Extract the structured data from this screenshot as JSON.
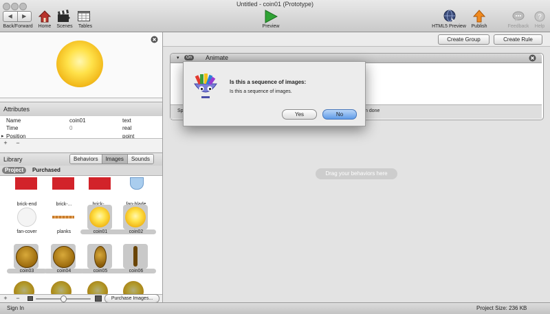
{
  "window": {
    "title": "Untitled - coin01 (Prototype)"
  },
  "toolbar": {
    "back_forward": "Back/Forward",
    "home": "Home",
    "scenes": "Scenes",
    "tables": "Tables",
    "preview": "Preview",
    "html5_preview": "HTML5 Preview",
    "publish": "Publish",
    "feedback": "Feedback",
    "help": "Help"
  },
  "attributes": {
    "title": "Attributes",
    "rows": [
      {
        "name": "Name",
        "value": "coin01",
        "type": "text"
      },
      {
        "name": "Time",
        "value": "0",
        "type": "real"
      },
      {
        "name": "Position",
        "value": "",
        "type": "point"
      }
    ],
    "add": "+",
    "remove": "−"
  },
  "library": {
    "title": "Library",
    "tabs": [
      "Behaviors",
      "Images",
      "Sounds"
    ],
    "active_tab": "Images",
    "subtabs": [
      "Project",
      "Purchased"
    ],
    "active_subtab": "Project",
    "items": [
      {
        "label": "brick-end",
        "kind": "brick"
      },
      {
        "label": "brick-...",
        "kind": "brick"
      },
      {
        "label": "brick-...",
        "kind": "brick"
      },
      {
        "label": "fan-blade",
        "kind": "fan"
      },
      {
        "label": "fan-cover",
        "kind": "cover"
      },
      {
        "label": "planks",
        "kind": "planks"
      },
      {
        "label": "coin01",
        "kind": "coin-bright"
      },
      {
        "label": "coin02",
        "kind": "coin"
      },
      {
        "label": "coin03",
        "kind": "coin-dark"
      },
      {
        "label": "coin04",
        "kind": "coin-dark"
      },
      {
        "label": "coin05",
        "kind": "coin-side"
      },
      {
        "label": "coin06",
        "kind": "coin-edge"
      }
    ],
    "purchase_button": "Purchase Images..."
  },
  "rules": {
    "create_group": "Create Group",
    "create_rule": "Create Rule",
    "behavior_title": "Animate",
    "behavior_toggle": "On",
    "footer_left": "Sp",
    "footer_right": "n done",
    "drag_hint": "Drag your behaviors here"
  },
  "dialog": {
    "title": "Is this a sequence of images:",
    "message": "Is this a sequence of images.",
    "yes": "Yes",
    "no": "No"
  },
  "status": {
    "sign_in": "Sign In",
    "project_size": "Project Size: 236 KB"
  },
  "colors": {
    "accent": "#5e9be8",
    "coin": "#f2b91b",
    "brick": "#d2232a"
  }
}
